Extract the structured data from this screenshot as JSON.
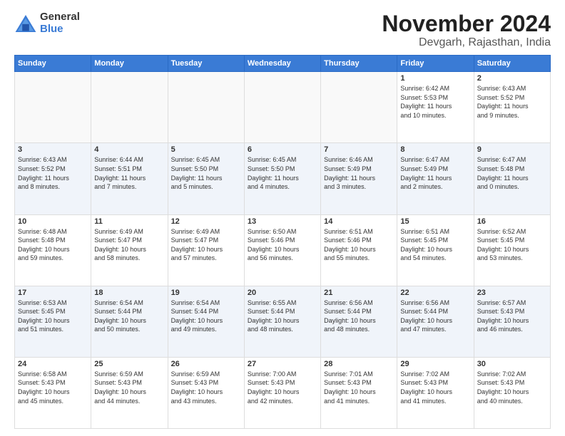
{
  "logo": {
    "general": "General",
    "blue": "Blue"
  },
  "title": "November 2024",
  "subtitle": "Devgarh, Rajasthan, India",
  "weekdays": [
    "Sunday",
    "Monday",
    "Tuesday",
    "Wednesday",
    "Thursday",
    "Friday",
    "Saturday"
  ],
  "weeks": [
    [
      {
        "day": "",
        "text": "",
        "empty": true
      },
      {
        "day": "",
        "text": "",
        "empty": true
      },
      {
        "day": "",
        "text": "",
        "empty": true
      },
      {
        "day": "",
        "text": "",
        "empty": true
      },
      {
        "day": "",
        "text": "",
        "empty": true
      },
      {
        "day": "1",
        "text": "Sunrise: 6:42 AM\nSunset: 5:53 PM\nDaylight: 11 hours\nand 10 minutes.",
        "empty": false
      },
      {
        "day": "2",
        "text": "Sunrise: 6:43 AM\nSunset: 5:52 PM\nDaylight: 11 hours\nand 9 minutes.",
        "empty": false
      }
    ],
    [
      {
        "day": "3",
        "text": "Sunrise: 6:43 AM\nSunset: 5:52 PM\nDaylight: 11 hours\nand 8 minutes.",
        "empty": false
      },
      {
        "day": "4",
        "text": "Sunrise: 6:44 AM\nSunset: 5:51 PM\nDaylight: 11 hours\nand 7 minutes.",
        "empty": false
      },
      {
        "day": "5",
        "text": "Sunrise: 6:45 AM\nSunset: 5:50 PM\nDaylight: 11 hours\nand 5 minutes.",
        "empty": false
      },
      {
        "day": "6",
        "text": "Sunrise: 6:45 AM\nSunset: 5:50 PM\nDaylight: 11 hours\nand 4 minutes.",
        "empty": false
      },
      {
        "day": "7",
        "text": "Sunrise: 6:46 AM\nSunset: 5:49 PM\nDaylight: 11 hours\nand 3 minutes.",
        "empty": false
      },
      {
        "day": "8",
        "text": "Sunrise: 6:47 AM\nSunset: 5:49 PM\nDaylight: 11 hours\nand 2 minutes.",
        "empty": false
      },
      {
        "day": "9",
        "text": "Sunrise: 6:47 AM\nSunset: 5:48 PM\nDaylight: 11 hours\nand 0 minutes.",
        "empty": false
      }
    ],
    [
      {
        "day": "10",
        "text": "Sunrise: 6:48 AM\nSunset: 5:48 PM\nDaylight: 10 hours\nand 59 minutes.",
        "empty": false
      },
      {
        "day": "11",
        "text": "Sunrise: 6:49 AM\nSunset: 5:47 PM\nDaylight: 10 hours\nand 58 minutes.",
        "empty": false
      },
      {
        "day": "12",
        "text": "Sunrise: 6:49 AM\nSunset: 5:47 PM\nDaylight: 10 hours\nand 57 minutes.",
        "empty": false
      },
      {
        "day": "13",
        "text": "Sunrise: 6:50 AM\nSunset: 5:46 PM\nDaylight: 10 hours\nand 56 minutes.",
        "empty": false
      },
      {
        "day": "14",
        "text": "Sunrise: 6:51 AM\nSunset: 5:46 PM\nDaylight: 10 hours\nand 55 minutes.",
        "empty": false
      },
      {
        "day": "15",
        "text": "Sunrise: 6:51 AM\nSunset: 5:45 PM\nDaylight: 10 hours\nand 54 minutes.",
        "empty": false
      },
      {
        "day": "16",
        "text": "Sunrise: 6:52 AM\nSunset: 5:45 PM\nDaylight: 10 hours\nand 53 minutes.",
        "empty": false
      }
    ],
    [
      {
        "day": "17",
        "text": "Sunrise: 6:53 AM\nSunset: 5:45 PM\nDaylight: 10 hours\nand 51 minutes.",
        "empty": false
      },
      {
        "day": "18",
        "text": "Sunrise: 6:54 AM\nSunset: 5:44 PM\nDaylight: 10 hours\nand 50 minutes.",
        "empty": false
      },
      {
        "day": "19",
        "text": "Sunrise: 6:54 AM\nSunset: 5:44 PM\nDaylight: 10 hours\nand 49 minutes.",
        "empty": false
      },
      {
        "day": "20",
        "text": "Sunrise: 6:55 AM\nSunset: 5:44 PM\nDaylight: 10 hours\nand 48 minutes.",
        "empty": false
      },
      {
        "day": "21",
        "text": "Sunrise: 6:56 AM\nSunset: 5:44 PM\nDaylight: 10 hours\nand 48 minutes.",
        "empty": false
      },
      {
        "day": "22",
        "text": "Sunrise: 6:56 AM\nSunset: 5:44 PM\nDaylight: 10 hours\nand 47 minutes.",
        "empty": false
      },
      {
        "day": "23",
        "text": "Sunrise: 6:57 AM\nSunset: 5:43 PM\nDaylight: 10 hours\nand 46 minutes.",
        "empty": false
      }
    ],
    [
      {
        "day": "24",
        "text": "Sunrise: 6:58 AM\nSunset: 5:43 PM\nDaylight: 10 hours\nand 45 minutes.",
        "empty": false
      },
      {
        "day": "25",
        "text": "Sunrise: 6:59 AM\nSunset: 5:43 PM\nDaylight: 10 hours\nand 44 minutes.",
        "empty": false
      },
      {
        "day": "26",
        "text": "Sunrise: 6:59 AM\nSunset: 5:43 PM\nDaylight: 10 hours\nand 43 minutes.",
        "empty": false
      },
      {
        "day": "27",
        "text": "Sunrise: 7:00 AM\nSunset: 5:43 PM\nDaylight: 10 hours\nand 42 minutes.",
        "empty": false
      },
      {
        "day": "28",
        "text": "Sunrise: 7:01 AM\nSunset: 5:43 PM\nDaylight: 10 hours\nand 41 minutes.",
        "empty": false
      },
      {
        "day": "29",
        "text": "Sunrise: 7:02 AM\nSunset: 5:43 PM\nDaylight: 10 hours\nand 41 minutes.",
        "empty": false
      },
      {
        "day": "30",
        "text": "Sunrise: 7:02 AM\nSunset: 5:43 PM\nDaylight: 10 hours\nand 40 minutes.",
        "empty": false
      }
    ]
  ]
}
